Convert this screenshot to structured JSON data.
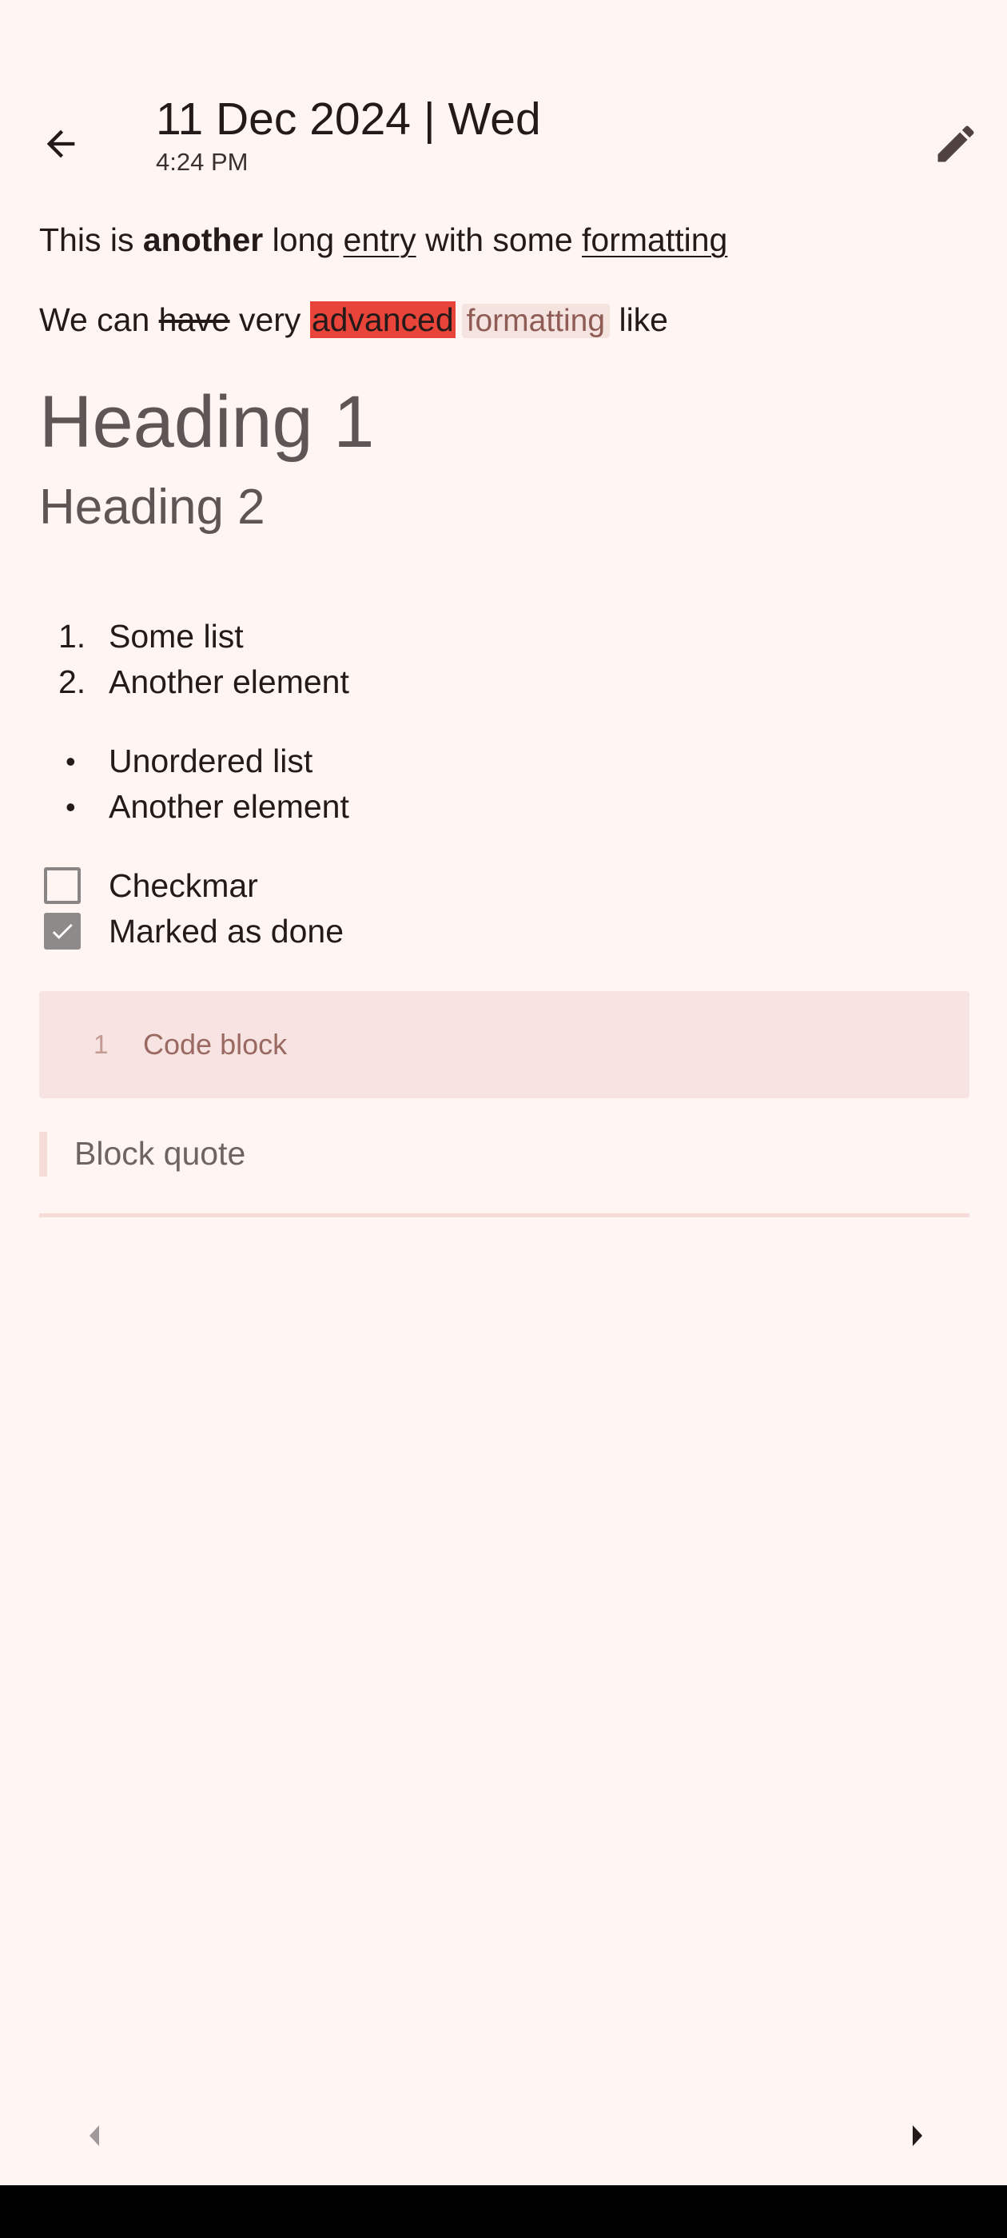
{
  "header": {
    "date": "11 Dec 2024 | Wed",
    "time": "4:24 PM"
  },
  "entry": {
    "para1": {
      "a": "This is ",
      "bold": "another",
      "b": " long ",
      "u1": "entry",
      "c": " with some ",
      "u2": "formatting"
    },
    "para2": {
      "a": "We can ",
      "strike": "have",
      "b": " very ",
      "highlight": "advanced",
      "code": "formatting",
      "c": " like"
    },
    "heading1": "Heading 1",
    "heading2": "Heading 2",
    "ordered_list": [
      {
        "marker": "1.",
        "text": "Some list"
      },
      {
        "marker": "2.",
        "text": "Another element"
      }
    ],
    "unordered_list": [
      {
        "marker": "•",
        "text": "Unordered list"
      },
      {
        "marker": "•",
        "text": "Another element"
      }
    ],
    "checklist": [
      {
        "text": "Checkmar",
        "checked": false
      },
      {
        "text": "Marked as done",
        "checked": true
      }
    ],
    "code_block": {
      "line_number": "1",
      "text": "Code block"
    },
    "block_quote": "Block quote"
  },
  "icons": {
    "back": "arrow-back-icon",
    "edit": "pencil-icon",
    "prev": "triangle-left-icon",
    "next": "triangle-right-icon"
  },
  "colors": {
    "background": "#fff5f3",
    "highlight": "#e8443a",
    "code_bg": "#f7e3e1",
    "checkbox_checked": "#8e8a8a"
  }
}
